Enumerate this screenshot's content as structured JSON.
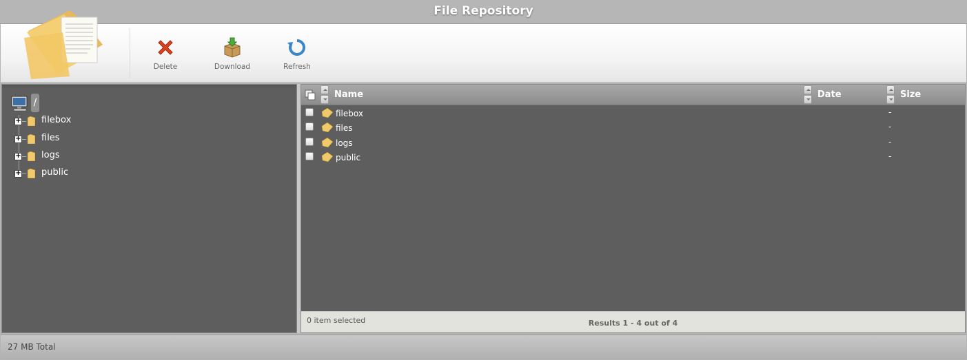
{
  "window": {
    "title": "File Repository"
  },
  "toolbar": {
    "buttons": [
      {
        "label": "Delete",
        "icon": "delete-icon"
      },
      {
        "label": "Download",
        "icon": "download-icon"
      },
      {
        "label": "Refresh",
        "icon": "refresh-icon"
      }
    ]
  },
  "tree": {
    "root_label": "/",
    "items": [
      {
        "label": "filebox",
        "expander": "+"
      },
      {
        "label": "files",
        "expander": "+"
      },
      {
        "label": "logs",
        "expander": "+"
      },
      {
        "label": "public",
        "expander": "+"
      }
    ]
  },
  "grid": {
    "columns": {
      "name": "Name",
      "date": "Date",
      "size": "Size"
    },
    "rows": [
      {
        "name": "filebox",
        "date": "",
        "size": "-"
      },
      {
        "name": "files",
        "date": "",
        "size": "-"
      },
      {
        "name": "logs",
        "date": "",
        "size": "-"
      },
      {
        "name": "public",
        "date": "",
        "size": "-"
      }
    ],
    "footer": {
      "selection_text": "0 item selected",
      "results_text": "Results 1 - 4 out of 4"
    }
  },
  "status": {
    "total": "27 MB Total"
  },
  "colors": {
    "panel_bg": "#5e5e5e",
    "folder": "#f0c96a",
    "delete_icon": "#d9411e",
    "refresh_icon": "#3a86c8"
  }
}
